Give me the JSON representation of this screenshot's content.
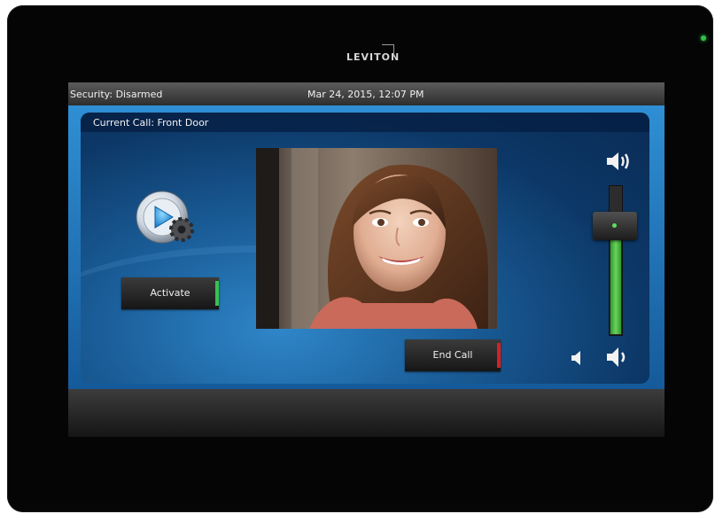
{
  "device": {
    "brand": "LEVITON",
    "led_color": "#31c14a"
  },
  "status_bar": {
    "security": "Security: Disarmed",
    "datetime": "Mar 24, 2015, 12:07 PM"
  },
  "call_panel": {
    "title": "Current Call: Front Door",
    "activate_label": "Activate",
    "end_call_label": "End Call"
  },
  "volume": {
    "level": 0.68,
    "icons": [
      "speaker-loud-icon",
      "speaker-quiet-icon",
      "speaker-medium-icon"
    ]
  },
  "colors": {
    "accent_green": "#38c050",
    "accent_red": "#d82020",
    "panel_blue": "#1a5d98"
  }
}
